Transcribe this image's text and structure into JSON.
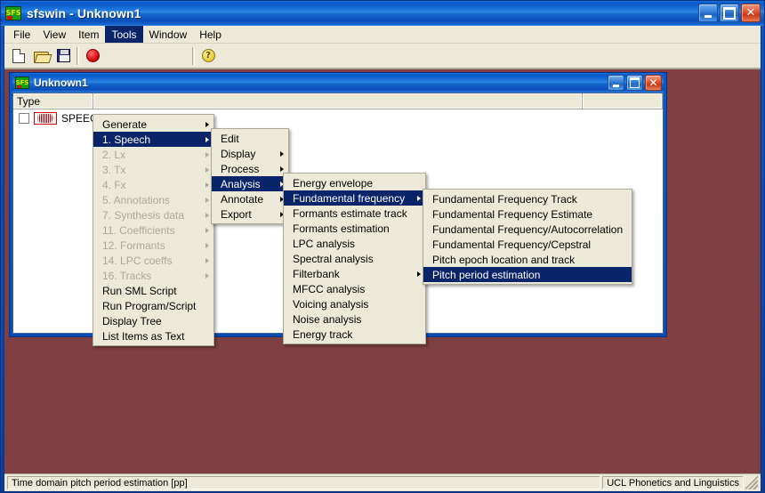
{
  "window": {
    "title": "sfswin - Unknown1",
    "icon": "sfs-logo-icon",
    "minimize_label": "Minimize",
    "maximize_label": "Maximize",
    "close_label": "Close"
  },
  "menubar": {
    "items": [
      {
        "label": "File",
        "active": false
      },
      {
        "label": "View",
        "active": false
      },
      {
        "label": "Item",
        "active": false
      },
      {
        "label": "Tools",
        "active": true
      },
      {
        "label": "Window",
        "active": false
      },
      {
        "label": "Help",
        "active": false
      }
    ]
  },
  "toolbar": {
    "buttons": [
      {
        "name": "new-file-button",
        "icon": "new-document-icon"
      },
      {
        "name": "open-file-button",
        "icon": "open-folder-icon"
      },
      {
        "name": "save-file-button",
        "icon": "floppy-disk-icon"
      },
      {
        "name": "record-button",
        "icon": "record-circle-icon"
      },
      {
        "name": "help-button",
        "icon": "help-question-icon",
        "glyph": "?"
      }
    ]
  },
  "menus": {
    "tools": {
      "title": "Tools",
      "items": [
        {
          "label": "Generate",
          "submenu": true,
          "disabled": false,
          "selected": false
        },
        {
          "label": "1. Speech",
          "submenu": true,
          "disabled": false,
          "selected": true
        },
        {
          "label": "2. Lx",
          "submenu": true,
          "disabled": true,
          "selected": false
        },
        {
          "label": "3. Tx",
          "submenu": true,
          "disabled": true,
          "selected": false
        },
        {
          "label": "4. Fx",
          "submenu": true,
          "disabled": true,
          "selected": false
        },
        {
          "label": "5. Annotations",
          "submenu": true,
          "disabled": true,
          "selected": false
        },
        {
          "label": "7. Synthesis data",
          "submenu": true,
          "disabled": true,
          "selected": false
        },
        {
          "label": "11. Coefficients",
          "submenu": true,
          "disabled": true,
          "selected": false
        },
        {
          "label": "12. Formants",
          "submenu": true,
          "disabled": true,
          "selected": false
        },
        {
          "label": "14. LPC coeffs",
          "submenu": true,
          "disabled": true,
          "selected": false
        },
        {
          "label": "16. Tracks",
          "submenu": true,
          "disabled": true,
          "selected": false
        },
        {
          "label": "Run SML Script",
          "submenu": false,
          "disabled": false,
          "selected": false
        },
        {
          "label": "Run Program/Script",
          "submenu": false,
          "disabled": false,
          "selected": false
        },
        {
          "label": "Display Tree",
          "submenu": false,
          "disabled": false,
          "selected": false
        },
        {
          "label": "List Items as Text",
          "submenu": false,
          "disabled": false,
          "selected": false
        }
      ]
    },
    "speech": {
      "title": "1. Speech",
      "items": [
        {
          "label": "Edit",
          "submenu": false,
          "disabled": false,
          "selected": false
        },
        {
          "label": "Display",
          "submenu": true,
          "disabled": false,
          "selected": false
        },
        {
          "label": "Process",
          "submenu": true,
          "disabled": false,
          "selected": false
        },
        {
          "label": "Analysis",
          "submenu": true,
          "disabled": false,
          "selected": true
        },
        {
          "label": "Annotate",
          "submenu": true,
          "disabled": false,
          "selected": false
        },
        {
          "label": "Export",
          "submenu": true,
          "disabled": false,
          "selected": false
        }
      ]
    },
    "analysis": {
      "title": "Analysis",
      "items": [
        {
          "label": "Energy envelope",
          "submenu": false,
          "disabled": false,
          "selected": false
        },
        {
          "label": "Fundamental frequency",
          "submenu": true,
          "disabled": false,
          "selected": true
        },
        {
          "label": "Formants estimate  track",
          "submenu": false,
          "disabled": false,
          "selected": false
        },
        {
          "label": "Formants estimation",
          "submenu": false,
          "disabled": false,
          "selected": false
        },
        {
          "label": "LPC analysis",
          "submenu": false,
          "disabled": false,
          "selected": false
        },
        {
          "label": "Spectral analysis",
          "submenu": false,
          "disabled": false,
          "selected": false
        },
        {
          "label": "Filterbank",
          "submenu": true,
          "disabled": false,
          "selected": false
        },
        {
          "label": "MFCC analysis",
          "submenu": false,
          "disabled": false,
          "selected": false
        },
        {
          "label": "Voicing analysis",
          "submenu": false,
          "disabled": false,
          "selected": false
        },
        {
          "label": "Noise analysis",
          "submenu": false,
          "disabled": false,
          "selected": false
        },
        {
          "label": "Energy track",
          "submenu": false,
          "disabled": false,
          "selected": false
        }
      ]
    },
    "fundamental_frequency": {
      "title": "Fundamental frequency",
      "items": [
        {
          "label": "Fundamental Frequency Track",
          "submenu": false,
          "disabled": false,
          "selected": false
        },
        {
          "label": "Fundamental Frequency Estimate",
          "submenu": false,
          "disabled": false,
          "selected": false
        },
        {
          "label": "Fundamental Frequency/Autocorrelation",
          "submenu": false,
          "disabled": false,
          "selected": false
        },
        {
          "label": "Fundamental Frequency/Cepstral",
          "submenu": false,
          "disabled": false,
          "selected": false
        },
        {
          "label": "Pitch epoch location and track",
          "submenu": false,
          "disabled": false,
          "selected": false
        },
        {
          "label": "Pitch period estimation",
          "submenu": false,
          "disabled": false,
          "selected": true
        }
      ]
    }
  },
  "mdi_child": {
    "title": "Unknown1",
    "icon": "sfs-logo-icon",
    "columns": [
      "Type",
      "",
      ""
    ],
    "rows": [
      {
        "checked": false,
        "icon": "waveform-icon",
        "label": "SPEECH"
      }
    ]
  },
  "statusbar": {
    "left": "Time domain pitch period estimation [pp]",
    "right": "UCL Phonetics and Linguistics"
  },
  "colors": {
    "titlebar_blue": "#0a58c8",
    "menu_highlight": "#0a246a",
    "mdi_background": "#7e4042",
    "control_face": "#ece9d8",
    "close_red": "#c63a18"
  }
}
